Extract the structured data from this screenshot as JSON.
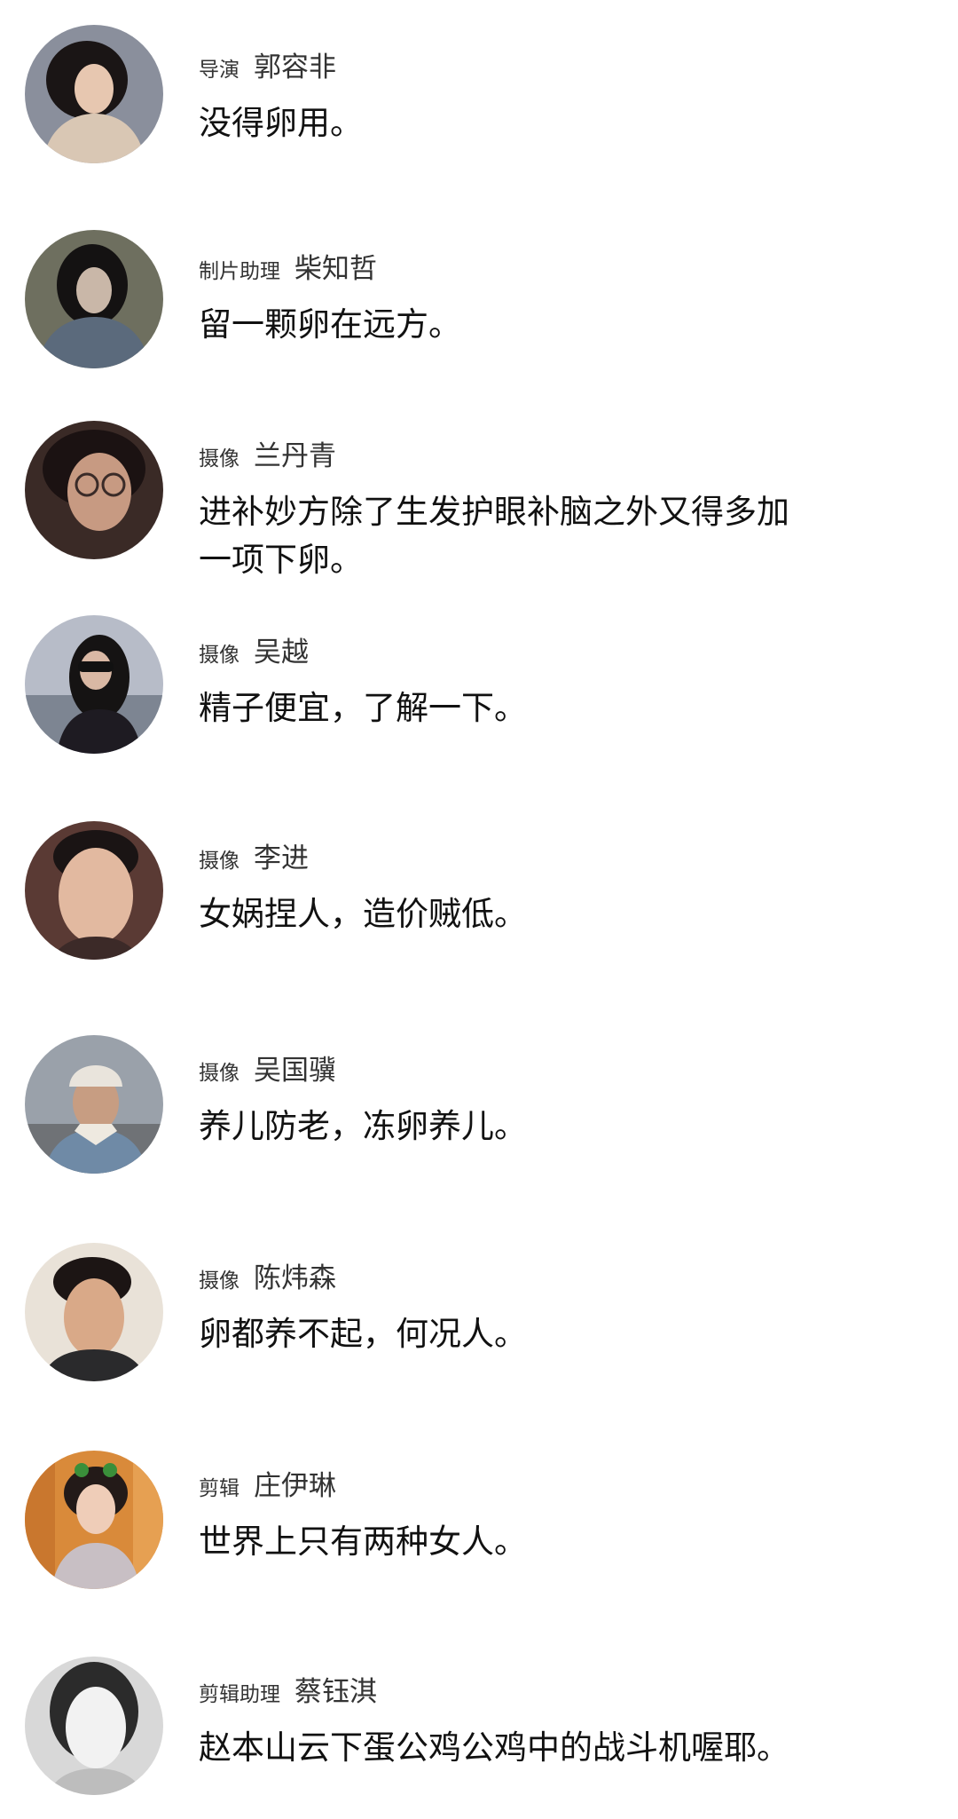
{
  "comments": [
    {
      "role": "导演",
      "name": "郭容非",
      "text": "没得卵用。",
      "avatar_icon": "portrait-woman-curly-hair",
      "avatar_bg": "#8a8f9c",
      "avatar_tone": "#e7c7b0",
      "avatar_hair": "#1a1515",
      "avatar_cloth": "#d9c7b4"
    },
    {
      "role": "制片助理",
      "name": "柴知哲",
      "text": "留一颗卵在远方。",
      "avatar_icon": "portrait-woman-dark-hair",
      "avatar_bg": "#6e6f5f",
      "avatar_tone": "#c9b7a8",
      "avatar_hair": "#141212",
      "avatar_cloth": "#5b6a7c"
    },
    {
      "role": "摄像",
      "name": "兰丹青",
      "text": "进补妙方除了生发护眼补脑之外又得多加\n一项下卵。",
      "avatar_icon": "portrait-woman-glasses",
      "avatar_bg": "#3a2a26",
      "avatar_tone": "#c79a82",
      "avatar_hair": "#1b1212",
      "avatar_cloth": "#4a3430"
    },
    {
      "role": "摄像",
      "name": "吴越",
      "text": "精子便宜，了解一下。",
      "avatar_icon": "portrait-woman-sunglasses",
      "avatar_bg": "#b7bcc8",
      "avatar_tone": "#d9b8a4",
      "avatar_hair": "#151313",
      "avatar_cloth": "#1e1b22"
    },
    {
      "role": "摄像",
      "name": "李进",
      "text": "女娲捏人，造价贼低。",
      "avatar_icon": "portrait-man-short-hair",
      "avatar_bg": "#5a3a34",
      "avatar_tone": "#e2b9a0",
      "avatar_hair": "#1a1414",
      "avatar_cloth": "#3c2a28"
    },
    {
      "role": "摄像",
      "name": "吴国骥",
      "text": "养儿防老，冻卵养儿。",
      "avatar_icon": "portrait-man-beanie",
      "avatar_bg": "#9aa1aa",
      "avatar_tone": "#c79d82",
      "avatar_hair": "#e9e4dc",
      "avatar_cloth": "#6f8aa6"
    },
    {
      "role": "摄像",
      "name": "陈炜森",
      "text": "卵都养不起，何况人。",
      "avatar_icon": "portrait-man-curly-hair",
      "avatar_bg": "#e9e2d8",
      "avatar_tone": "#d9a988",
      "avatar_hair": "#1c1514",
      "avatar_cloth": "#2a2a2c"
    },
    {
      "role": "剪辑",
      "name": "庄伊琳",
      "text": "世界上只有两种女人。",
      "avatar_icon": "portrait-woman-headband",
      "avatar_bg": "#d98a3a",
      "avatar_tone": "#efcdb8",
      "avatar_hair": "#231a18",
      "avatar_cloth": "#c8bfc4"
    },
    {
      "role": "剪辑助理",
      "name": "蔡钰淇",
      "text": "赵本山云下蛋公鸡公鸡中的战斗机喔耶。",
      "avatar_icon": "portrait-woman-grayscale",
      "avatar_bg": "#d8d8d8",
      "avatar_tone": "#f2f2f2",
      "avatar_hair": "#2b2b2b",
      "avatar_cloth": "#bdbdbd"
    }
  ]
}
